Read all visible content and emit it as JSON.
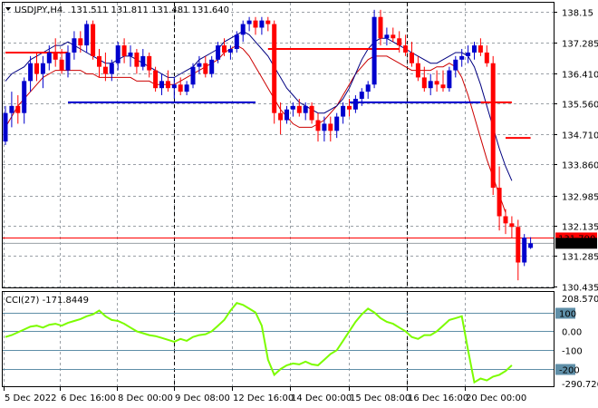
{
  "header": {
    "symbol": "USDJPY,H4",
    "ohlc": "131.511 131.811 131.481 131.640",
    "dropdown_icon": "triangle-down-icon"
  },
  "indicator": {
    "label": "CCI(27) -171.8449",
    "scale_top": "208.5703",
    "scale_bottom": "-290.7262"
  },
  "chart_data": {
    "type": "candlestick",
    "symbol": "USDJPY",
    "timeframe": "H4",
    "price_axis": {
      "ticks": [
        "138.15",
        "137.285",
        "136.410",
        "135.560",
        "134.710",
        "133.860",
        "132.985",
        "132.135",
        "131.285",
        "130.435"
      ],
      "values": [
        138.15,
        137.285,
        136.41,
        135.56,
        134.71,
        133.86,
        132.985,
        132.135,
        131.285,
        130.435
      ],
      "range": [
        130.4,
        138.4
      ]
    },
    "price_markers": [
      {
        "label": "131.790",
        "value": 131.79,
        "color": "#ff0000"
      },
      {
        "label": "131.640",
        "value": 131.64,
        "color": "#000000"
      }
    ],
    "time_axis": [
      "5 Dec 2022",
      "6 Dec 16:00",
      "8 Dec 00:00",
      "9 Dec 08:00",
      "12 Dec 16:00",
      "14 Dec 00:00",
      "15 Dec 08:00",
      "16 Dec 16:00",
      "20 Dec 00:00"
    ],
    "candles": [
      {
        "o": 134.5,
        "h": 135.5,
        "l": 134.4,
        "c": 135.3
      },
      {
        "o": 135.3,
        "h": 135.9,
        "l": 134.9,
        "c": 135.5
      },
      {
        "o": 135.5,
        "h": 135.8,
        "l": 135.0,
        "c": 135.3
      },
      {
        "o": 135.3,
        "h": 136.3,
        "l": 135.0,
        "c": 136.2
      },
      {
        "o": 136.2,
        "h": 136.9,
        "l": 135.9,
        "c": 136.7
      },
      {
        "o": 136.7,
        "h": 137.0,
        "l": 136.2,
        "c": 136.4
      },
      {
        "o": 136.4,
        "h": 136.9,
        "l": 136.0,
        "c": 136.7
      },
      {
        "o": 136.7,
        "h": 137.2,
        "l": 136.5,
        "c": 137.0
      },
      {
        "o": 137.0,
        "h": 137.4,
        "l": 136.6,
        "c": 136.8
      },
      {
        "o": 136.8,
        "h": 137.1,
        "l": 136.4,
        "c": 136.5
      },
      {
        "o": 136.5,
        "h": 137.2,
        "l": 136.3,
        "c": 137.0
      },
      {
        "o": 137.0,
        "h": 137.6,
        "l": 136.8,
        "c": 137.4
      },
      {
        "o": 137.4,
        "h": 137.6,
        "l": 137.0,
        "c": 137.2
      },
      {
        "o": 137.2,
        "h": 137.9,
        "l": 137.0,
        "c": 137.8
      },
      {
        "o": 137.8,
        "h": 137.9,
        "l": 136.8,
        "c": 136.9
      },
      {
        "o": 136.9,
        "h": 137.1,
        "l": 136.3,
        "c": 136.6
      },
      {
        "o": 136.6,
        "h": 137.0,
        "l": 136.2,
        "c": 136.4
      },
      {
        "o": 136.4,
        "h": 136.8,
        "l": 136.2,
        "c": 136.7
      },
      {
        "o": 136.7,
        "h": 137.3,
        "l": 136.5,
        "c": 137.2
      },
      {
        "o": 137.2,
        "h": 137.4,
        "l": 136.7,
        "c": 136.9
      },
      {
        "o": 136.9,
        "h": 137.2,
        "l": 136.6,
        "c": 137.0
      },
      {
        "o": 137.0,
        "h": 137.1,
        "l": 136.4,
        "c": 136.6
      },
      {
        "o": 136.6,
        "h": 137.1,
        "l": 136.5,
        "c": 136.9
      },
      {
        "o": 136.9,
        "h": 137.0,
        "l": 136.3,
        "c": 136.5
      },
      {
        "o": 136.5,
        "h": 136.6,
        "l": 135.9,
        "c": 136.0
      },
      {
        "o": 136.0,
        "h": 136.4,
        "l": 135.8,
        "c": 136.2
      },
      {
        "o": 136.2,
        "h": 136.5,
        "l": 135.9,
        "c": 136.0
      },
      {
        "o": 136.0,
        "h": 136.3,
        "l": 135.7,
        "c": 136.1
      },
      {
        "o": 136.1,
        "h": 136.3,
        "l": 135.8,
        "c": 135.9
      },
      {
        "o": 135.9,
        "h": 136.2,
        "l": 135.8,
        "c": 136.1
      },
      {
        "o": 136.1,
        "h": 136.7,
        "l": 136.0,
        "c": 136.6
      },
      {
        "o": 136.6,
        "h": 136.9,
        "l": 136.4,
        "c": 136.7
      },
      {
        "o": 136.7,
        "h": 136.9,
        "l": 136.3,
        "c": 136.4
      },
      {
        "o": 136.4,
        "h": 136.9,
        "l": 136.3,
        "c": 136.8
      },
      {
        "o": 136.8,
        "h": 137.3,
        "l": 136.7,
        "c": 137.2
      },
      {
        "o": 137.2,
        "h": 137.4,
        "l": 136.9,
        "c": 137.0
      },
      {
        "o": 137.0,
        "h": 137.2,
        "l": 136.8,
        "c": 137.1
      },
      {
        "o": 137.1,
        "h": 137.6,
        "l": 137.0,
        "c": 137.5
      },
      {
        "o": 137.5,
        "h": 137.9,
        "l": 137.3,
        "c": 137.8
      },
      {
        "o": 137.8,
        "h": 138.0,
        "l": 137.6,
        "c": 137.9
      },
      {
        "o": 137.9,
        "h": 138.0,
        "l": 137.5,
        "c": 137.7
      },
      {
        "o": 137.7,
        "h": 138.0,
        "l": 137.5,
        "c": 137.9
      },
      {
        "o": 137.9,
        "h": 138.0,
        "l": 137.6,
        "c": 137.8
      },
      {
        "o": 137.8,
        "h": 137.9,
        "l": 135.0,
        "c": 135.3
      },
      {
        "o": 135.3,
        "h": 135.6,
        "l": 134.7,
        "c": 135.1
      },
      {
        "o": 135.1,
        "h": 135.5,
        "l": 135.0,
        "c": 135.4
      },
      {
        "o": 135.4,
        "h": 135.6,
        "l": 135.2,
        "c": 135.5
      },
      {
        "o": 135.5,
        "h": 135.7,
        "l": 135.2,
        "c": 135.3
      },
      {
        "o": 135.3,
        "h": 135.6,
        "l": 135.1,
        "c": 135.5
      },
      {
        "o": 135.5,
        "h": 135.6,
        "l": 135.0,
        "c": 135.1
      },
      {
        "o": 135.1,
        "h": 135.3,
        "l": 134.5,
        "c": 134.8
      },
      {
        "o": 134.8,
        "h": 135.2,
        "l": 134.5,
        "c": 135.0
      },
      {
        "o": 135.0,
        "h": 135.2,
        "l": 134.5,
        "c": 134.8
      },
      {
        "o": 134.8,
        "h": 135.3,
        "l": 134.6,
        "c": 135.2
      },
      {
        "o": 135.2,
        "h": 135.6,
        "l": 135.0,
        "c": 135.5
      },
      {
        "o": 135.5,
        "h": 135.7,
        "l": 135.2,
        "c": 135.4
      },
      {
        "o": 135.4,
        "h": 135.8,
        "l": 135.3,
        "c": 135.7
      },
      {
        "o": 135.7,
        "h": 136.0,
        "l": 135.5,
        "c": 135.9
      },
      {
        "o": 135.9,
        "h": 136.2,
        "l": 135.7,
        "c": 136.1
      },
      {
        "o": 136.1,
        "h": 138.2,
        "l": 136.0,
        "c": 138.0
      },
      {
        "o": 138.0,
        "h": 138.2,
        "l": 137.2,
        "c": 137.4
      },
      {
        "o": 137.4,
        "h": 137.7,
        "l": 137.2,
        "c": 137.5
      },
      {
        "o": 137.5,
        "h": 137.7,
        "l": 137.3,
        "c": 137.4
      },
      {
        "o": 137.4,
        "h": 137.6,
        "l": 137.0,
        "c": 137.2
      },
      {
        "o": 137.2,
        "h": 137.5,
        "l": 136.9,
        "c": 137.0
      },
      {
        "o": 137.0,
        "h": 137.3,
        "l": 136.6,
        "c": 136.7
      },
      {
        "o": 136.7,
        "h": 136.9,
        "l": 136.2,
        "c": 136.3
      },
      {
        "o": 136.3,
        "h": 136.6,
        "l": 135.9,
        "c": 136.0
      },
      {
        "o": 136.0,
        "h": 136.4,
        "l": 135.8,
        "c": 136.2
      },
      {
        "o": 136.2,
        "h": 136.5,
        "l": 135.9,
        "c": 136.1
      },
      {
        "o": 136.1,
        "h": 136.5,
        "l": 135.9,
        "c": 136.0
      },
      {
        "o": 136.0,
        "h": 136.6,
        "l": 135.9,
        "c": 136.5
      },
      {
        "o": 136.5,
        "h": 136.9,
        "l": 136.3,
        "c": 136.8
      },
      {
        "o": 136.8,
        "h": 137.1,
        "l": 136.6,
        "c": 136.9
      },
      {
        "o": 136.9,
        "h": 137.2,
        "l": 136.7,
        "c": 137.0
      },
      {
        "o": 137.0,
        "h": 137.3,
        "l": 136.8,
        "c": 137.2
      },
      {
        "o": 137.2,
        "h": 137.4,
        "l": 136.9,
        "c": 137.0
      },
      {
        "o": 137.0,
        "h": 137.2,
        "l": 136.6,
        "c": 136.7
      },
      {
        "o": 136.7,
        "h": 136.9,
        "l": 133.0,
        "c": 133.2
      },
      {
        "o": 133.2,
        "h": 133.8,
        "l": 132.0,
        "c": 132.4
      },
      {
        "o": 132.4,
        "h": 132.6,
        "l": 131.9,
        "c": 132.2
      },
      {
        "o": 132.2,
        "h": 132.4,
        "l": 131.8,
        "c": 132.1
      },
      {
        "o": 132.1,
        "h": 132.3,
        "l": 130.6,
        "c": 131.1
      },
      {
        "o": 131.1,
        "h": 131.9,
        "l": 131.0,
        "c": 131.8
      },
      {
        "o": 131.511,
        "h": 131.811,
        "l": 131.481,
        "c": 131.64
      }
    ],
    "lines": {
      "ma_fast_navy": [
        136.2,
        136.4,
        136.5,
        136.6,
        136.8,
        136.9,
        137.0,
        137.1,
        137.2,
        137.2,
        137.3,
        137.2,
        137.1,
        137.0,
        136.9,
        136.8,
        136.7,
        136.7,
        136.8,
        136.9,
        136.9,
        136.8,
        136.7,
        136.6,
        136.5,
        136.4,
        136.3,
        136.3,
        136.4,
        136.5,
        136.6,
        136.8,
        136.9,
        137.0,
        137.1,
        137.3,
        137.4,
        137.5,
        137.6,
        137.5,
        137.3,
        137.1,
        136.9,
        136.6,
        136.3,
        136.0,
        135.8,
        135.6,
        135.5,
        135.4,
        135.3,
        135.3,
        135.4,
        135.5,
        135.7,
        136.0,
        136.4,
        136.8,
        137.1,
        137.3,
        137.4,
        137.4,
        137.3,
        137.2,
        137.1,
        137.0,
        136.9,
        136.8,
        136.7,
        136.7,
        136.8,
        136.9,
        137.0,
        137.0,
        136.9,
        136.6,
        136.1,
        135.5,
        134.9,
        134.3,
        133.8,
        133.4
      ],
      "ma_slow_red": [
        134.9,
        135.2,
        135.5,
        135.7,
        135.9,
        136.1,
        136.3,
        136.4,
        136.5,
        136.5,
        136.5,
        136.5,
        136.5,
        136.4,
        136.4,
        136.3,
        136.3,
        136.3,
        136.3,
        136.3,
        136.3,
        136.2,
        136.2,
        136.2,
        136.1,
        136.1,
        136.1,
        136.1,
        136.2,
        136.3,
        136.4,
        136.5,
        136.6,
        136.7,
        136.8,
        137.0,
        137.1,
        137.2,
        137.1,
        136.9,
        136.6,
        136.3,
        136.0,
        135.7,
        135.4,
        135.2,
        135.0,
        134.9,
        134.9,
        134.9,
        135.0,
        135.1,
        135.3,
        135.5,
        135.8,
        136.1,
        136.4,
        136.6,
        136.8,
        136.9,
        136.9,
        136.9,
        136.8,
        136.7,
        136.6,
        136.5,
        136.5,
        136.5,
        136.5,
        136.6,
        136.6,
        136.7,
        136.6,
        136.3,
        135.8,
        135.2,
        134.6,
        134.0,
        133.5,
        133.0,
        132.5
      ],
      "supertrend_red_upper": [
        {
          "from": 0,
          "to": 10,
          "value": 137.0
        },
        {
          "from": 42,
          "to": 63,
          "value": 137.1
        },
        {
          "from": 76,
          "to": 81,
          "value": 135.6
        },
        {
          "from": 80,
          "to": 84,
          "value": 134.6
        }
      ],
      "supertrend_blue_lower": [
        {
          "from": 10,
          "to": 40,
          "value": 135.6
        },
        {
          "from": 55,
          "to": 76,
          "value": 135.6
        }
      ]
    },
    "cci": {
      "period": 27,
      "current": -171.8449,
      "levels": [
        100,
        0,
        -100,
        -200
      ],
      "range": [
        -290.7262,
        208.5703
      ],
      "values": [
        -30,
        -20,
        -5,
        10,
        25,
        30,
        20,
        35,
        40,
        30,
        45,
        55,
        65,
        80,
        90,
        110,
        80,
        60,
        55,
        40,
        20,
        0,
        -10,
        -20,
        -25,
        -35,
        -45,
        -55,
        -40,
        -50,
        -30,
        -20,
        -15,
        0,
        30,
        60,
        110,
        150,
        140,
        120,
        100,
        30,
        -150,
        -230,
        -200,
        -180,
        -170,
        -175,
        -160,
        -175,
        -180,
        -150,
        -120,
        -100,
        -50,
        0,
        50,
        90,
        120,
        100,
        70,
        50,
        40,
        20,
        0,
        -30,
        -40,
        -20,
        -20,
        0,
        30,
        60,
        70,
        80,
        -100,
        -270,
        -250,
        -260,
        -240,
        -230,
        -210,
        -180
      ],
      "color": "#7cfc00"
    },
    "colors": {
      "bull": "#0000cd",
      "bear": "#ff0000",
      "ma_fast": "#000080",
      "ma_slow": "#cc0000",
      "grid": "#9aa0a6"
    },
    "grid": true
  }
}
